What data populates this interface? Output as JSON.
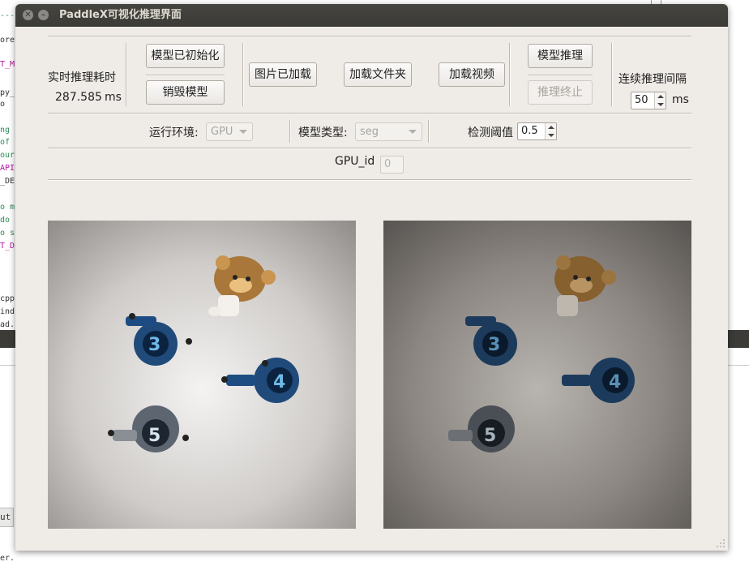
{
  "background_editor": {
    "lines": [
      {
        "text": "----",
        "color": "#2e8b57"
      },
      {
        "text": "ore",
        "color": "#333333"
      },
      {
        "text": "T_M",
        "color": "#b5179e"
      },
      {
        "text": "py_",
        "color": "#333333"
      },
      {
        "text": "o",
        "color": "#333333"
      },
      {
        "text": "ng",
        "color": "#2e8b57"
      },
      {
        "text": " of",
        "color": "#2e8b57"
      },
      {
        "text": "our",
        "color": "#2e8b57"
      },
      {
        "text": "API",
        "color": "#b5179e"
      },
      {
        "text": "_DE",
        "color": "#333333"
      },
      {
        "text": "o m",
        "color": "#2e8b57"
      },
      {
        "text": " do",
        "color": "#2e8b57"
      },
      {
        "text": "o s",
        "color": "#2e8b57"
      },
      {
        "text": "T_D",
        "color": "#b5179e"
      },
      {
        "text": "cpp",
        "color": "#333333"
      },
      {
        "text": "ind",
        "color": "#333333"
      },
      {
        "text": "ad.",
        "color": "#333333"
      }
    ],
    "status_label": "ut",
    "bottom_line": "er."
  },
  "window": {
    "title": "PaddleX可视化推理界面",
    "close_icon": "close-icon",
    "minimize_icon": "minimize-icon"
  },
  "toolbar": {
    "inference_time_label": "实时推理耗时",
    "inference_time_value": "287.585",
    "inference_time_unit": "ms",
    "init_model_button": "模型已初始化",
    "destroy_model_button": "销毁模型",
    "image_loaded_button": "图片已加载",
    "load_folder_button": "加载文件夹",
    "load_video_button": "加载视频",
    "infer_button": "模型推理",
    "stop_infer_button": "推理终止",
    "interval_label": "连续推理间隔",
    "interval_value": "50",
    "interval_unit": "ms"
  },
  "settings": {
    "env_label": "运行环境:",
    "env_value": "GPU",
    "model_type_label": "模型类型:",
    "model_type_value": "seg",
    "threshold_label": "检测阈值",
    "threshold_value": "0.5",
    "gpu_id_label": "GPU_id",
    "gpu_id_value": "0"
  },
  "images": {
    "input_image": "input-photo",
    "output_image": "segmentation-result-photo"
  }
}
